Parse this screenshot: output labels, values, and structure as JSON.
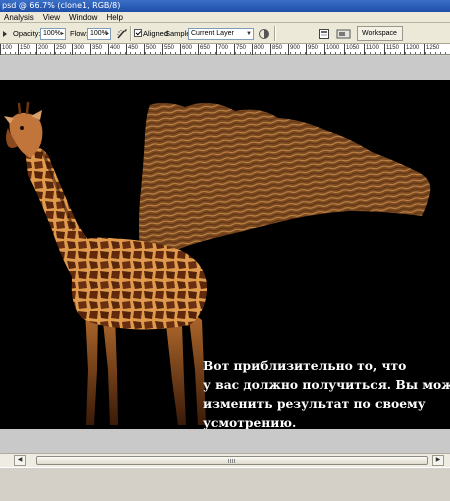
{
  "window": {
    "title": "psd @ 66.7% (clone1, RGB/8)"
  },
  "menu": {
    "items": [
      "Analysis",
      "View",
      "Window",
      "Help"
    ]
  },
  "options": {
    "opacity_label": "Opacity:",
    "opacity_value": "100%",
    "flow_label": "Flow:",
    "flow_value": "100%",
    "aligned_label": "Aligned",
    "aligned_checked": true,
    "sample_label": "Sample:",
    "sample_value": "Current Layer",
    "workspace_label": "Workspace"
  },
  "ruler": {
    "ticks": [
      "100",
      "150",
      "200",
      "250",
      "300",
      "350",
      "400",
      "450",
      "500",
      "550",
      "600",
      "650",
      "700",
      "750",
      "800",
      "850",
      "900",
      "950",
      "1000",
      "1050",
      "1100",
      "1150",
      "1200",
      "1250"
    ]
  },
  "caption": {
    "lines": [
      "Вот приблизительно то, что",
      "у вас должно получиться. Вы можете",
      "изменить результат по своему",
      "усмотрению."
    ]
  },
  "colors": {
    "canvas": "#000000",
    "texture": "#8a5628",
    "giraffe_base": "#c77a35",
    "giraffe_spots": "#4a200a"
  },
  "icons": [
    "brush-options-icon",
    "airbrush-icon",
    "clone-source-icon",
    "ignore-adjustment-icon",
    "workspace-dropdown-icon"
  ]
}
